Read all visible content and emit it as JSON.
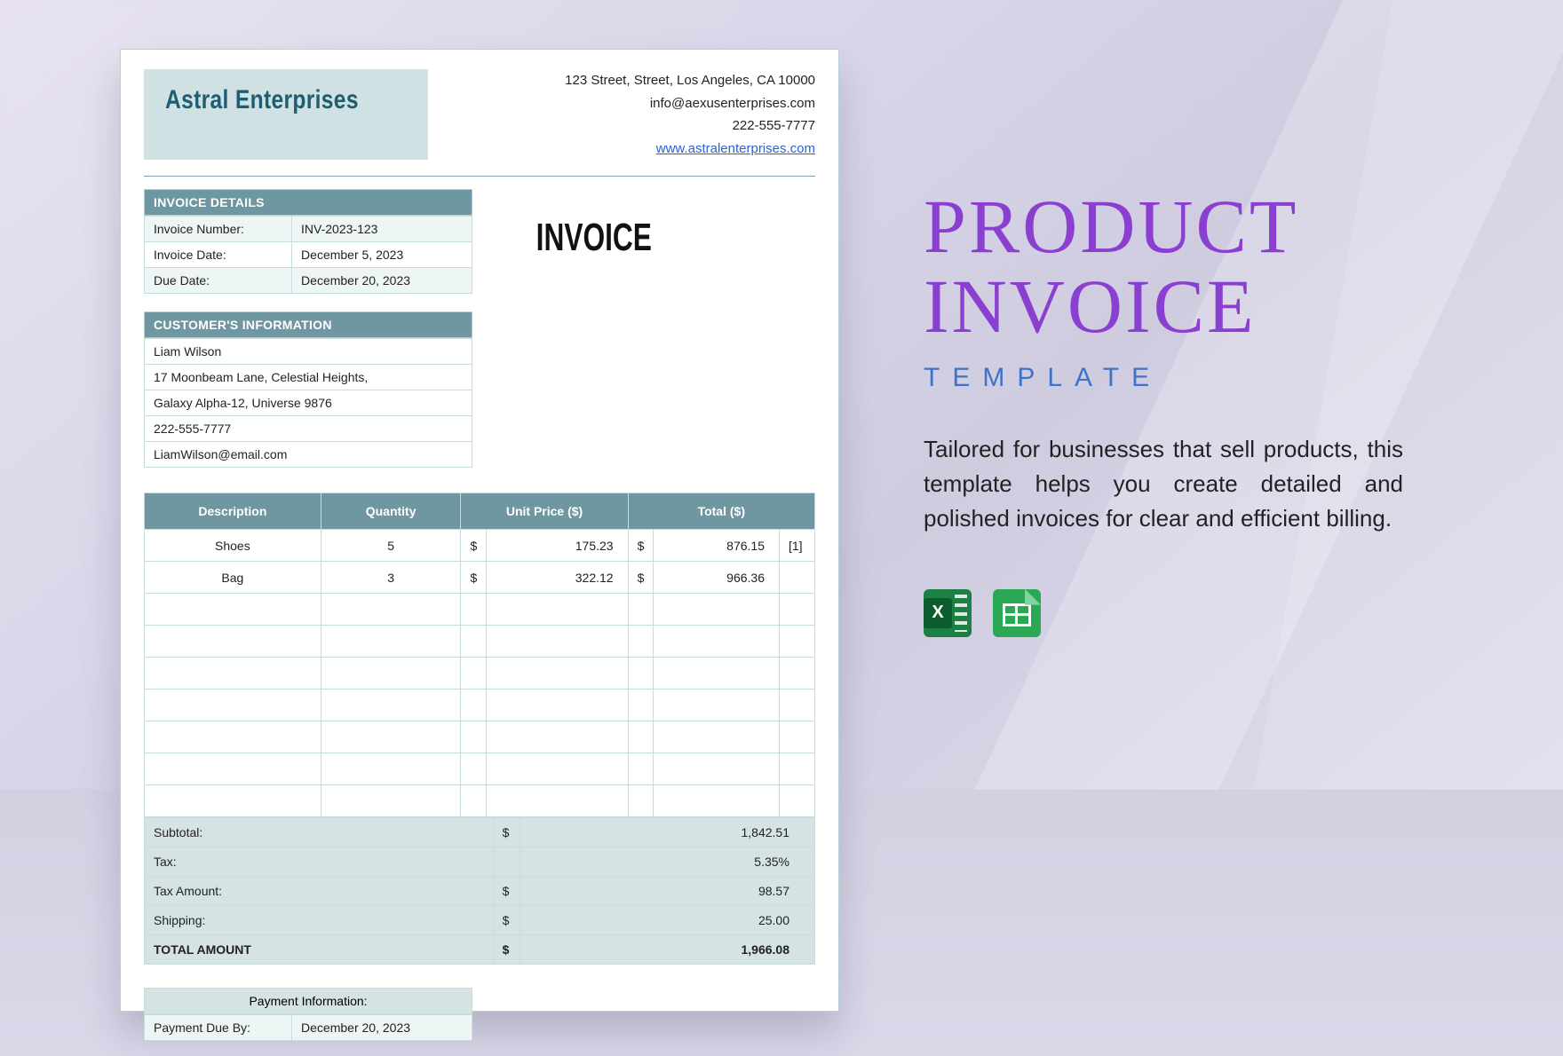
{
  "company": {
    "name": "Astral Enterprises",
    "address": "123 Street, Street, Los Angeles, CA 10000",
    "email": "info@aexusenterprises.com",
    "phone": "222-555-7777",
    "website": "www.astralenterprises.com"
  },
  "invoice_label": "INVOICE",
  "details": {
    "heading": "INVOICE DETAILS",
    "rows": [
      {
        "label": "Invoice Number:",
        "value": "INV-2023-123"
      },
      {
        "label": "Invoice Date:",
        "value": "December 5, 2023"
      },
      {
        "label": "Due Date:",
        "value": "December 20, 2023"
      }
    ]
  },
  "customer": {
    "heading": "CUSTOMER'S INFORMATION",
    "lines": [
      "Liam Wilson",
      "17 Moonbeam Lane, Celestial Heights,",
      "Galaxy Alpha-12, Universe 9876",
      "222-555-7777",
      "LiamWilson@email.com"
    ]
  },
  "items": {
    "headers": {
      "desc": "Description",
      "qty": "Quantity",
      "unit": "Unit Price ($)",
      "total": "Total ($)"
    },
    "rows": [
      {
        "desc": "Shoes",
        "qty": "5",
        "unit": "175.23",
        "total": "876.15",
        "note": "[1]"
      },
      {
        "desc": "Bag",
        "qty": "3",
        "unit": "322.12",
        "total": "966.36",
        "note": ""
      }
    ],
    "blank_rows": 7
  },
  "totals": {
    "rows": [
      {
        "label": "Subtotal:",
        "currency": "$",
        "value": "1,842.51"
      },
      {
        "label": "Tax:",
        "currency": "",
        "value": "5.35%"
      },
      {
        "label": "Tax Amount:",
        "currency": "$",
        "value": "98.57"
      },
      {
        "label": "Shipping:",
        "currency": "$",
        "value": "25.00"
      }
    ],
    "grand": {
      "label": "TOTAL AMOUNT",
      "currency": "$",
      "value": "1,966.08"
    }
  },
  "payment": {
    "heading": "Payment Information:",
    "row": {
      "label": "Payment Due By:",
      "value": "December 20, 2023"
    }
  },
  "promo": {
    "title_line1": "PRODUCT",
    "title_line2": "INVOICE",
    "subtitle": "TEMPLATE",
    "description": "Tailored for businesses that sell products, this template helps you create detailed and polished invoices for clear and efficient billing."
  }
}
